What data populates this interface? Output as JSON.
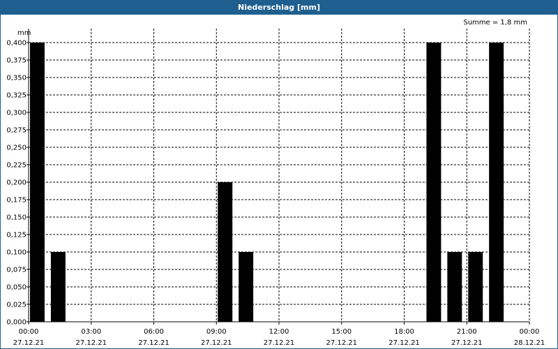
{
  "window": {
    "title": "Niederschlag [mm]"
  },
  "chart_data": {
    "type": "bar",
    "title": "Niederschlag [mm]",
    "ylabel": "mm",
    "annotation": "Summe = 1,8 mm",
    "ylim": [
      0,
      0.4
    ],
    "yticks": [
      0,
      0.025,
      0.05,
      0.075,
      0.1,
      0.125,
      0.15,
      0.175,
      0.2,
      0.225,
      0.25,
      0.275,
      0.3,
      0.325,
      0.35,
      0.375,
      0.4
    ],
    "ytick_labels": [
      "0,000",
      "0,025",
      "0,050",
      "0,075",
      "0,100",
      "0,125",
      "0,150",
      "0,175",
      "0,200",
      "0,225",
      "0,250",
      "0,275",
      "0,300",
      "0,325",
      "0,350",
      "0,375",
      "0,400"
    ],
    "xlim_hours": [
      0,
      24
    ],
    "xticks": [
      {
        "time": "00:00",
        "date": "27.12.21"
      },
      {
        "time": "03:00",
        "date": "27.12.21"
      },
      {
        "time": "06:00",
        "date": "27.12.21"
      },
      {
        "time": "09:00",
        "date": "27.12.21"
      },
      {
        "time": "12:00",
        "date": "27.12.21"
      },
      {
        "time": "15:00",
        "date": "27.12.21"
      },
      {
        "time": "18:00",
        "date": "27.12.21"
      },
      {
        "time": "21:00",
        "date": "27.12.21"
      },
      {
        "time": "00:00",
        "date": "28.12.21"
      }
    ],
    "x": [
      "00:00",
      "01:00",
      "09:00",
      "10:00",
      "19:00",
      "20:00",
      "21:00",
      "22:00"
    ],
    "values": [
      0.4,
      0.1,
      0.2,
      0.1,
      0.4,
      0.1,
      0.1,
      0.4
    ],
    "grid": true,
    "bar_color": "#000000"
  }
}
